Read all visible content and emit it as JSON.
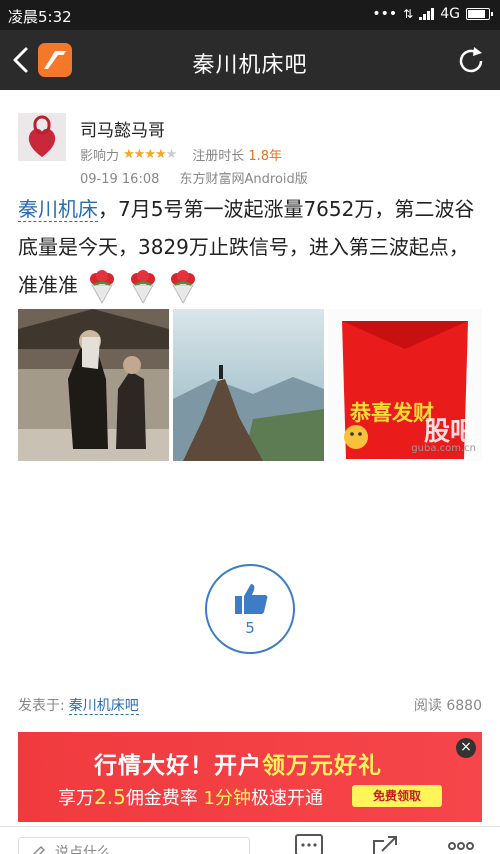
{
  "status_bar": {
    "time": "凌晨5:32",
    "network": "4G"
  },
  "nav": {
    "title": "秦川机床吧"
  },
  "post": {
    "author": "司马懿马哥",
    "influence_label": "影响力",
    "influence_rating": 4,
    "influence_max": 5,
    "reg_label": "注册时长",
    "reg_value": "1.8年",
    "date": "09-19 16:08",
    "source": "东方财富网Android版",
    "stock_link": "秦川机床",
    "text": "，7月5号第一波起涨量7652万，第二波谷底量是今天，3829万止跌信号，进入第三波起点，准准准",
    "image3_caption": "恭喜发财",
    "watermark": "股吧",
    "watermark_url": "guba.com.cn"
  },
  "like": {
    "count": "5"
  },
  "footer": {
    "posted_in_label": "发表于:",
    "posted_in_bar": "秦川机床吧",
    "reads_label": "阅读",
    "reads_value": "6880"
  },
  "ad": {
    "line1_a": "行情大好！开户",
    "line1_b": "领万元好礼",
    "line2_a": "享万",
    "line2_b": "2.5",
    "line2_c": "佣金费率",
    "line2_d": "1分钟",
    "line2_e": "极速开通",
    "button": "免费领取",
    "close": "×"
  },
  "bottom_bar": {
    "comment_placeholder": "说点什么"
  }
}
